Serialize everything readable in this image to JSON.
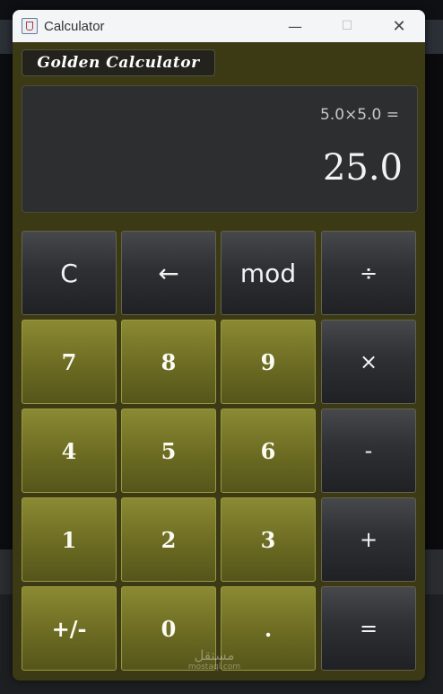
{
  "window": {
    "title": "Calculator"
  },
  "app": {
    "brand": "Golden Calculator"
  },
  "display": {
    "expression": "5.0×5.0 =",
    "result": "25.0"
  },
  "buttons": {
    "clear": "C",
    "backspace": "←",
    "mod": "mod",
    "divide": "÷",
    "seven": "7",
    "eight": "8",
    "nine": "9",
    "multiply": "×",
    "four": "4",
    "five": "5",
    "six": "6",
    "subtract": "-",
    "one": "1",
    "two": "2",
    "three": "3",
    "add": "+",
    "negate": "+/-",
    "zero": "0",
    "decimal": ".",
    "equals": "="
  },
  "watermark": {
    "logo": "مستقل",
    "domain": "mostaql.com"
  },
  "colors": {
    "accent_gold": "#6c6b22",
    "dark_button": "#2f3033",
    "window_bg": "#3b3a15"
  }
}
